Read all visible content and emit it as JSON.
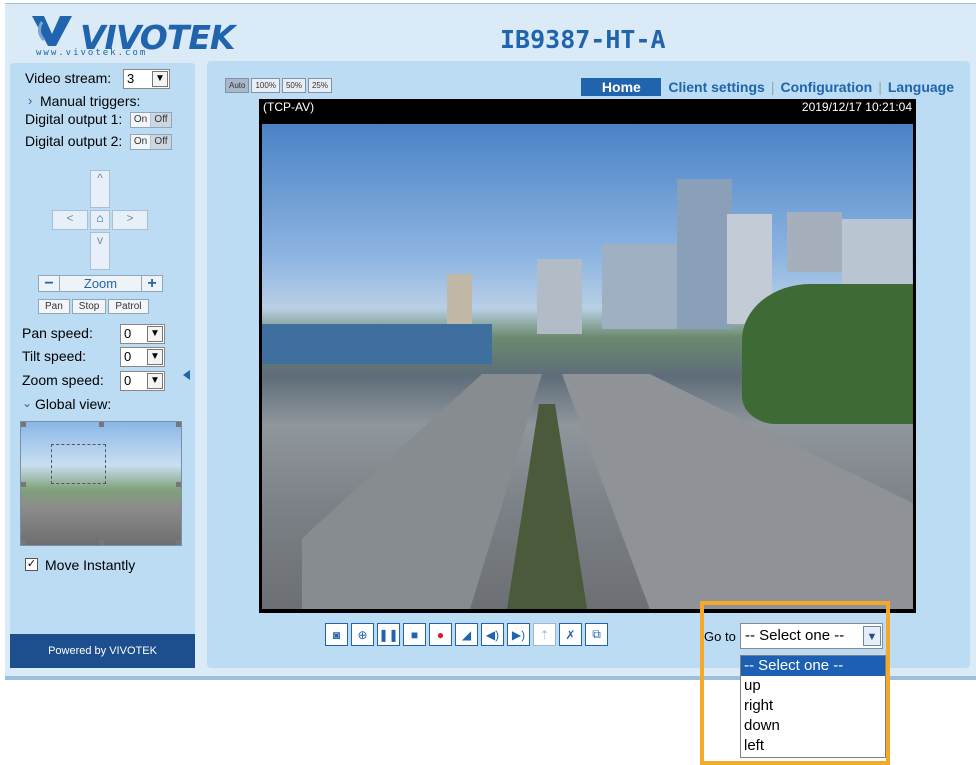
{
  "header": {
    "logo_text": "VIVOTEK",
    "logo_subtext": "www.vivotek.com",
    "model": "IB9387-HT-A"
  },
  "left_panel": {
    "video_stream_label": "Video stream:",
    "video_stream_value": "3",
    "manual_triggers_label": "Manual triggers:",
    "digital_output_1_label": "Digital output 1:",
    "digital_output_2_label": "Digital output 2:",
    "on_label": "On",
    "off_label": "Off",
    "zoom_label": "Zoom",
    "zoom_minus": "−",
    "zoom_plus": "+",
    "pan_label": "Pan",
    "stop_label": "Stop",
    "patrol_label": "Patrol",
    "pan_speed_label": "Pan speed:",
    "pan_speed_value": "0",
    "tilt_speed_label": "Tilt speed:",
    "tilt_speed_value": "0",
    "zoom_speed_label": "Zoom speed:",
    "zoom_speed_value": "0",
    "global_view_label": "Global view:",
    "move_instantly_label": "Move Instantly",
    "move_instantly_checked": "✓",
    "powered_by": "Powered by VIVOTEK"
  },
  "main": {
    "size_buttons": [
      "Auto",
      "100%",
      "50%",
      "25%"
    ],
    "nav": {
      "home": "Home",
      "client_settings": "Client settings",
      "configuration": "Configuration",
      "language": "Language"
    },
    "video": {
      "protocol": "(TCP-AV)",
      "timestamp": "2019/12/17 10:21:04"
    },
    "goto_label": "Go to",
    "goto_selected": "-- Select one --"
  },
  "dropdown": {
    "options": [
      "-- Select one --",
      "up",
      "right",
      "down",
      "left"
    ]
  },
  "colors": {
    "brand_blue": "#1f64ac",
    "panel_bg": "#bcdcf4",
    "highlight": "#f4a92c",
    "selected_option": "#1d5fb3"
  }
}
